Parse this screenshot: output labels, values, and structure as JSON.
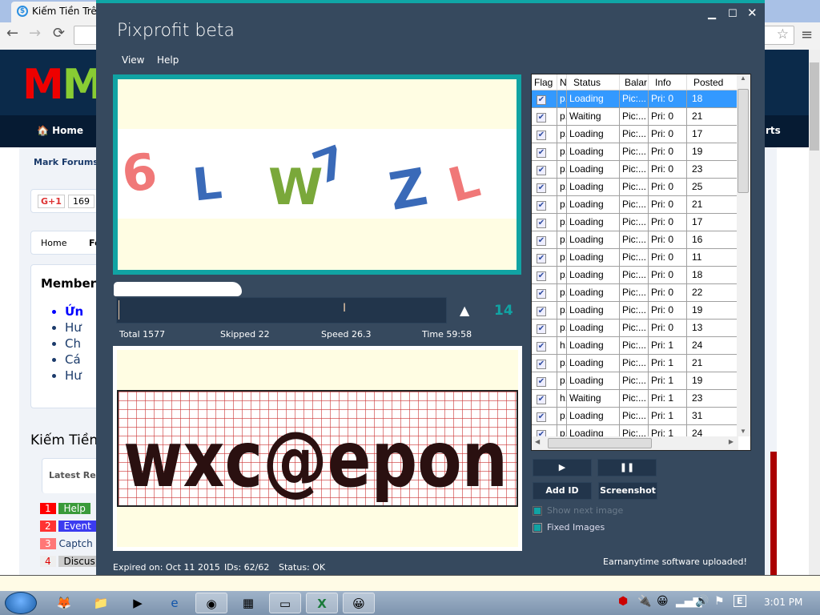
{
  "browser": {
    "tab_title": "Kiếm Tiền Trên",
    "logo": "MMO",
    "nav": {
      "home": "Home",
      "right": "rts"
    },
    "mark_forums": "Mark Forums",
    "gplus": "G+1",
    "gplus_count": "169",
    "breadcrumb": [
      "Home",
      "Fo"
    ],
    "member_heading": "Member c",
    "member_links": [
      "Ứn",
      "Hư",
      "Ch",
      "Cá",
      "Hư"
    ],
    "section_title": "Kiếm Tiền",
    "tab_latest": "Latest Rep",
    "latest": [
      {
        "n": "1",
        "label": "Help",
        "color": "#3a9a3a"
      },
      {
        "n": "2",
        "label": "Event",
        "color": "#3b3bf0"
      },
      {
        "n": "3",
        "label": "Captch",
        "color": ""
      },
      {
        "n": "4",
        "label": "Discus",
        "color": "#ccc"
      }
    ]
  },
  "app": {
    "title": "Pixprofit beta",
    "menu": [
      "View",
      "Help"
    ],
    "captcha_text": [
      "6",
      "L",
      "W",
      "7",
      "Z",
      "L"
    ],
    "captcha2_text": "wxc@epon",
    "answer_value": "",
    "count": "14",
    "stats": {
      "total": "Total 1577",
      "skipped": "Skipped 22",
      "speed": "Speed 26.3",
      "time": "Time 59:58"
    },
    "footer": {
      "expired": "Expired on: Oct 11 2015",
      "ids": "IDs: 62/62",
      "status": "Status: OK",
      "message": "Earnanytime software uploaded!"
    },
    "table": {
      "columns": [
        "Flag",
        "N",
        "Status",
        "Balar",
        "Info",
        "Posted"
      ],
      "rows": [
        [
          "p..",
          "Loading",
          "Pic:...",
          "Pri: 0",
          "18"
        ],
        [
          "p..",
          "Waiting",
          "Pic:...",
          "Pri: 0",
          "21"
        ],
        [
          "p..",
          "Loading",
          "Pic:...",
          "Pri: 0",
          "17"
        ],
        [
          "p..",
          "Loading",
          "Pic:...",
          "Pri: 0",
          "19"
        ],
        [
          "p..",
          "Loading",
          "Pic:...",
          "Pri: 0",
          "23"
        ],
        [
          "p..",
          "Loading",
          "Pic:...",
          "Pri: 0",
          "25"
        ],
        [
          "p..",
          "Loading",
          "Pic:...",
          "Pri: 0",
          "21"
        ],
        [
          "p..",
          "Loading",
          "Pic:...",
          "Pri: 0",
          "17"
        ],
        [
          "p..",
          "Loading",
          "Pic:...",
          "Pri: 0",
          "16"
        ],
        [
          "p..",
          "Loading",
          "Pic:...",
          "Pri: 0",
          "11"
        ],
        [
          "p..",
          "Loading",
          "Pic:...",
          "Pri: 0",
          "18"
        ],
        [
          "p..",
          "Loading",
          "Pic:...",
          "Pri: 0",
          "22"
        ],
        [
          "p..",
          "Loading",
          "Pic:...",
          "Pri: 0",
          "19"
        ],
        [
          "p..",
          "Loading",
          "Pic:...",
          "Pri: 0",
          "13"
        ],
        [
          "h..",
          "Loading",
          "Pic:...",
          "Pri: 1",
          "24"
        ],
        [
          "p..",
          "Loading",
          "Pic:...",
          "Pri: 1",
          "21"
        ],
        [
          "p..",
          "Loading",
          "Pic:...",
          "Pri: 1",
          "19"
        ],
        [
          "h..",
          "Waiting",
          "Pic:...",
          "Pri: 1",
          "23"
        ],
        [
          "p..",
          "Loading",
          "Pic:...",
          "Pri: 1",
          "31"
        ],
        [
          "p..",
          "Loading",
          "Pic:...",
          "Pri: 1",
          "24"
        ]
      ]
    },
    "buttons": {
      "play": "▶",
      "pause": "❚❚",
      "add_id": "Add ID",
      "screenshot": "Screenshot"
    },
    "checkboxes": [
      {
        "label": "Show next image",
        "checked": true,
        "disabled": true
      },
      {
        "label": "Fixed Images",
        "checked": true,
        "disabled": false
      }
    ]
  },
  "taskbar": {
    "clock": "3:01 PM"
  },
  "colors": {
    "accent": "#11a3a3",
    "window": "#36495e",
    "selection": "#3399ff"
  }
}
